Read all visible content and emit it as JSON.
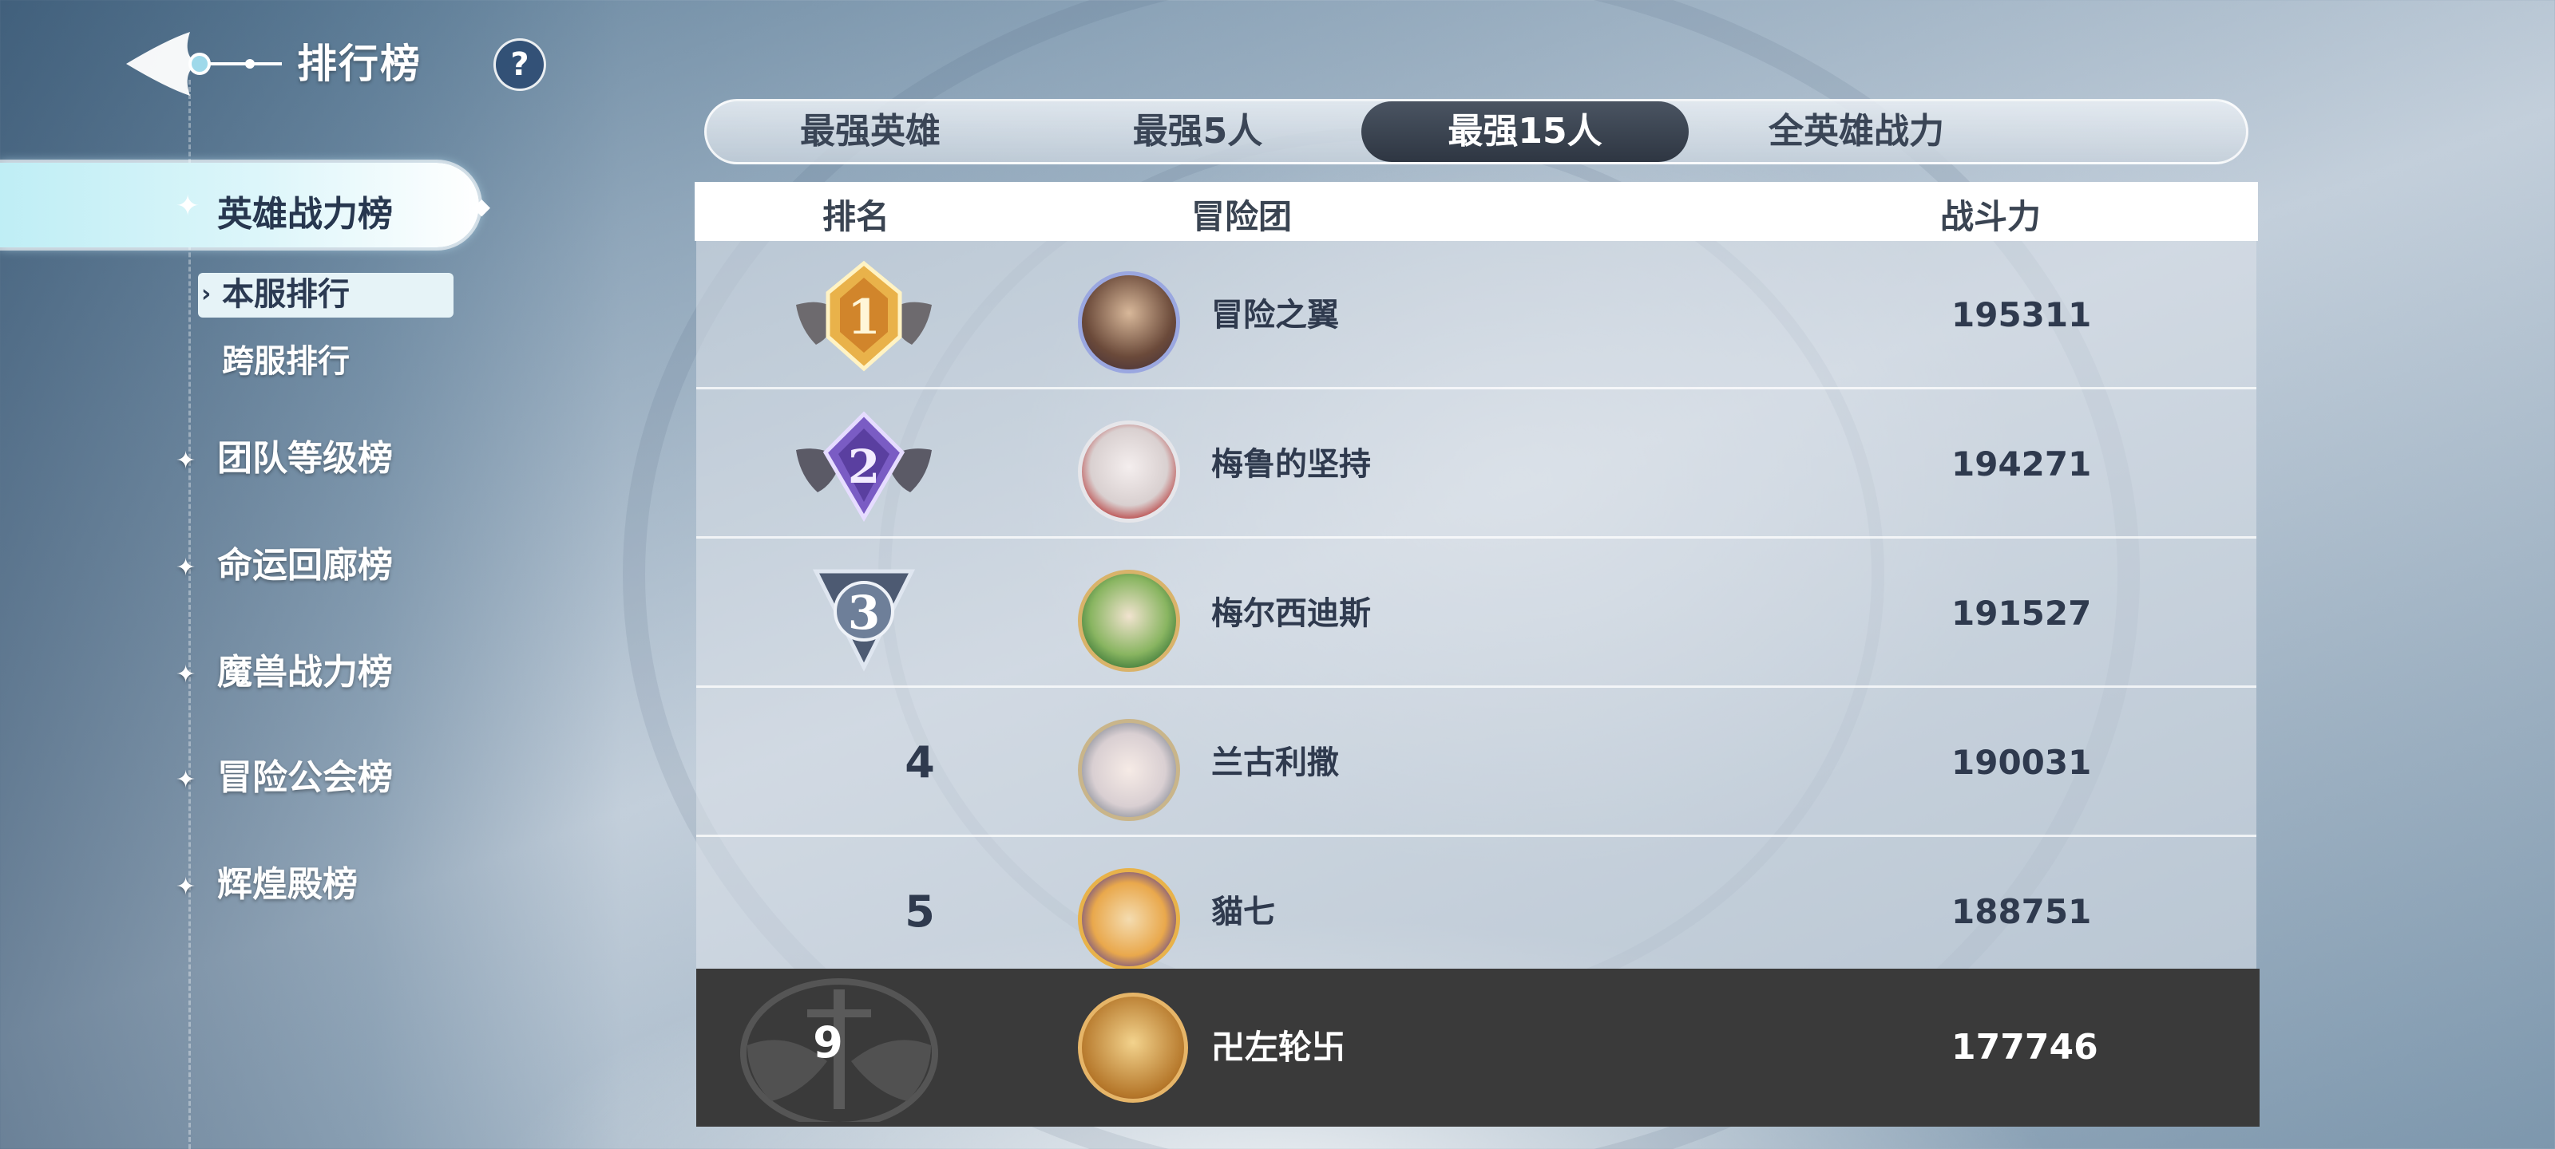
{
  "header": {
    "title": "排行榜",
    "help_icon": "question-icon",
    "help_label": "?"
  },
  "sidebar": {
    "active_item": {
      "label": "英雄战力榜",
      "icon": "star-icon"
    },
    "sub_items": [
      {
        "label": "本服排行",
        "active": true
      },
      {
        "label": "跨服排行",
        "active": false
      }
    ],
    "items": [
      {
        "label": "团队等级榜",
        "icon": "star-icon"
      },
      {
        "label": "命运回廊榜",
        "icon": "star-icon"
      },
      {
        "label": "魔兽战力榜",
        "icon": "star-icon"
      },
      {
        "label": "冒险公会榜",
        "icon": "star-icon"
      },
      {
        "label": "辉煌殿榜",
        "icon": "star-icon"
      }
    ]
  },
  "tabs": [
    {
      "label": "最强英雄",
      "active": false
    },
    {
      "label": "最强5人",
      "active": false
    },
    {
      "label": "最强15人",
      "active": true
    },
    {
      "label": "全英雄战力",
      "active": false
    }
  ],
  "table": {
    "headers": {
      "rank": "排名",
      "team": "冒险团",
      "power": "战斗力"
    },
    "rows": [
      {
        "rank": "1",
        "medal": "gold-medal-icon",
        "name": "冒险之翼",
        "power": "195311"
      },
      {
        "rank": "2",
        "medal": "purple-medal-icon",
        "name": "梅鲁的坚持",
        "power": "194271"
      },
      {
        "rank": "3",
        "medal": "silver-medal-icon",
        "name": "梅尔西迪斯",
        "power": "191527"
      },
      {
        "rank": "4",
        "name": "兰古利撒",
        "power": "190031"
      },
      {
        "rank": "5",
        "name": "貓七",
        "power": "188751"
      }
    ]
  },
  "my_rank": {
    "rank": "9",
    "name": "卍左轮卐",
    "power": "177746"
  },
  "colors": {
    "gold": "#e9b24a",
    "purple": "#7a5cc4",
    "silver": "#6e7f99",
    "active_tab": "#2e3642",
    "my_row": "#3a3a3a"
  }
}
